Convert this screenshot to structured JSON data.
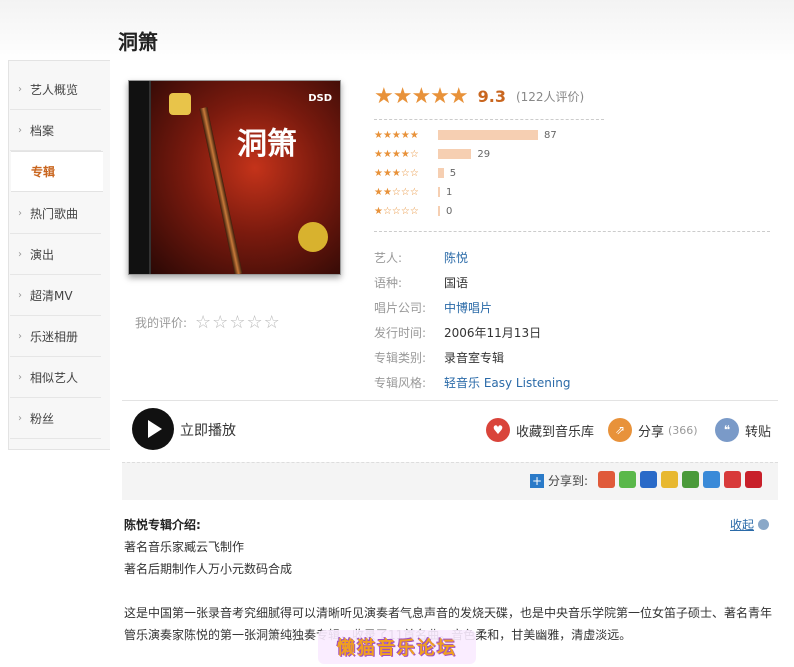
{
  "page": {
    "title": "洞箫"
  },
  "sidebar": {
    "items": [
      {
        "label": "艺人概览"
      },
      {
        "label": "档案"
      },
      {
        "label": "专辑",
        "active": true
      },
      {
        "label": "热门歌曲"
      },
      {
        "label": "演出"
      },
      {
        "label": "超清MV"
      },
      {
        "label": "乐迷相册"
      },
      {
        "label": "相似艺人"
      },
      {
        "label": "粉丝"
      }
    ]
  },
  "album": {
    "cover_label_dsd": "DSD",
    "cover_title": "洞箫",
    "my_rating_label": "我的评价:",
    "my_rating_stars": "☆☆☆☆☆",
    "rating": {
      "stars": "★★★★★",
      "score": "9.3",
      "count": "(122人评价)"
    },
    "rating_bars": [
      {
        "stars": "★★★★★",
        "value": 87,
        "label": "87"
      },
      {
        "stars": "★★★★☆",
        "value": 29,
        "label": "29"
      },
      {
        "stars": "★★★☆☆",
        "value": 5,
        "label": "5"
      },
      {
        "stars": "★★☆☆☆",
        "value": 1,
        "label": "1"
      },
      {
        "stars": "★☆☆☆☆",
        "value": 0,
        "label": "0"
      }
    ],
    "info": [
      {
        "key": "艺人:",
        "value": "陈悦",
        "link": true
      },
      {
        "key": "语种:",
        "value": "国语",
        "link": false
      },
      {
        "key": "唱片公司:",
        "value": "中博唱片",
        "link": true
      },
      {
        "key": "发行时间:",
        "value": "2006年11月13日",
        "link": false
      },
      {
        "key": "专辑类别:",
        "value": "录音室专辑",
        "link": false
      },
      {
        "key": "专辑风格:",
        "value": "轻音乐 Easy Listening",
        "link": true
      }
    ]
  },
  "actions": {
    "play": "立即播放",
    "collect": "收藏到音乐库",
    "share": "分享",
    "share_count": "(366)",
    "repost": "转贴"
  },
  "share_bar": {
    "label": "分享到:",
    "plus": "+"
  },
  "intro": {
    "title": "陈悦专辑介绍:",
    "collapse": "收起",
    "lines": [
      "著名音乐家臧云飞制作",
      "著名后期制作人万小元数码合成"
    ],
    "paragraph": "这是中国第一张录音考究细腻得可以清晰听见演奏者气息声音的发烧天碟，也是中央音乐学院第一位女笛子硕士、著名青年管乐演奏家陈悦的第一张洞箫纯独奏专辑，收录了11首名曲。音色柔和，甘美幽雅，清虚淡远。"
  },
  "watermark": "懒猫音乐论坛",
  "colors": {
    "accent": "#c9661f",
    "link": "#2a6aa8",
    "star": "#e8923a",
    "bar": "#f6cfb2"
  }
}
